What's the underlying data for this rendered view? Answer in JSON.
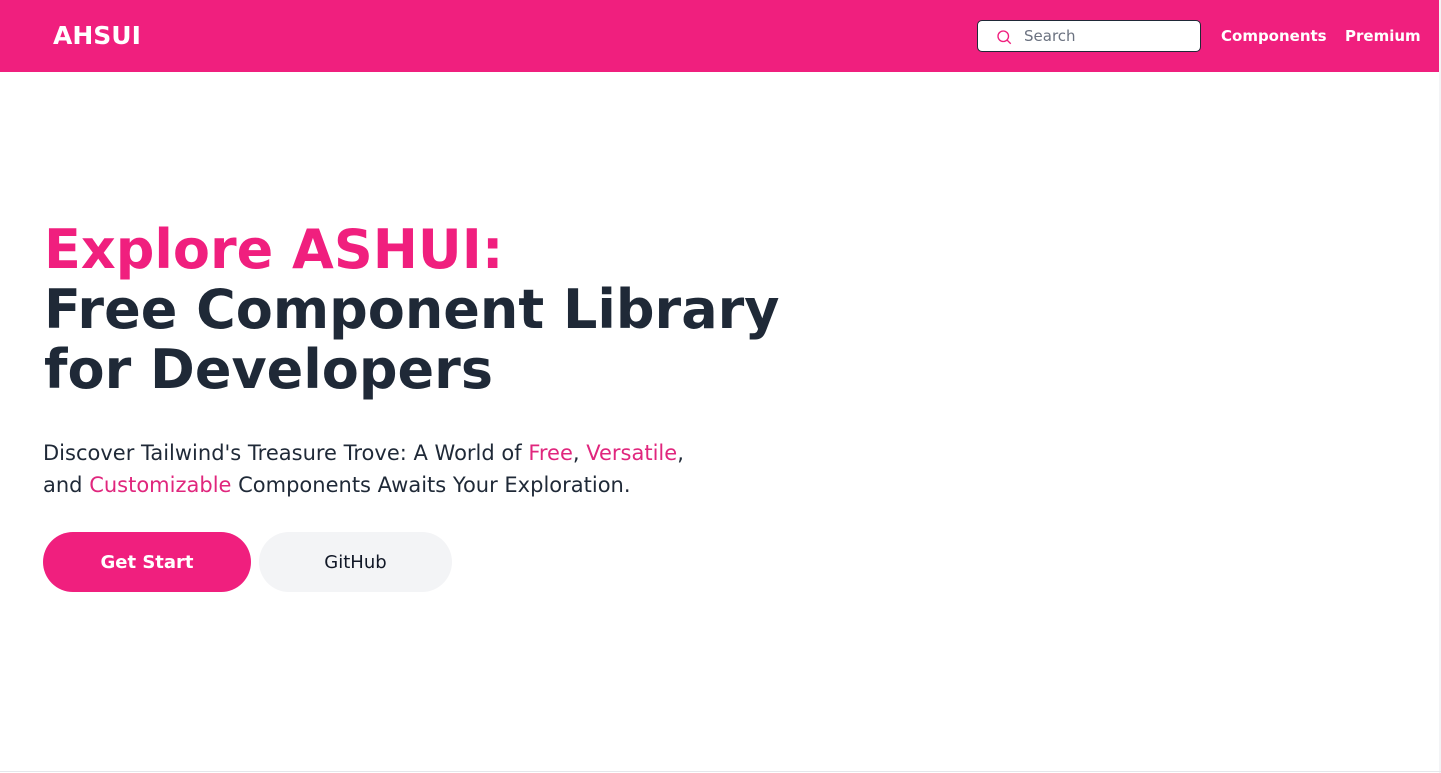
{
  "brand": {
    "logo_text": "AHSUI",
    "accent_color": "#f01f7e"
  },
  "nav": {
    "search_placeholder": "Search",
    "links": [
      {
        "label": "Components"
      },
      {
        "label": "Premium"
      }
    ]
  },
  "hero": {
    "title_accent": "Explore ASHUI:",
    "title_line1": "Free Component Library",
    "title_line2": "for Developers",
    "subtitle": {
      "part1": "Discover Tailwind's Treasure Trove: A World of ",
      "hl1": "Free",
      "sep1": ", ",
      "hl2": "Versatile",
      "part2": ",",
      "part3": "and ",
      "hl3": "Customizable",
      "part4": " Components Awaits Your Exploration."
    },
    "primary_button": "Get Start",
    "secondary_button": "GitHub"
  }
}
